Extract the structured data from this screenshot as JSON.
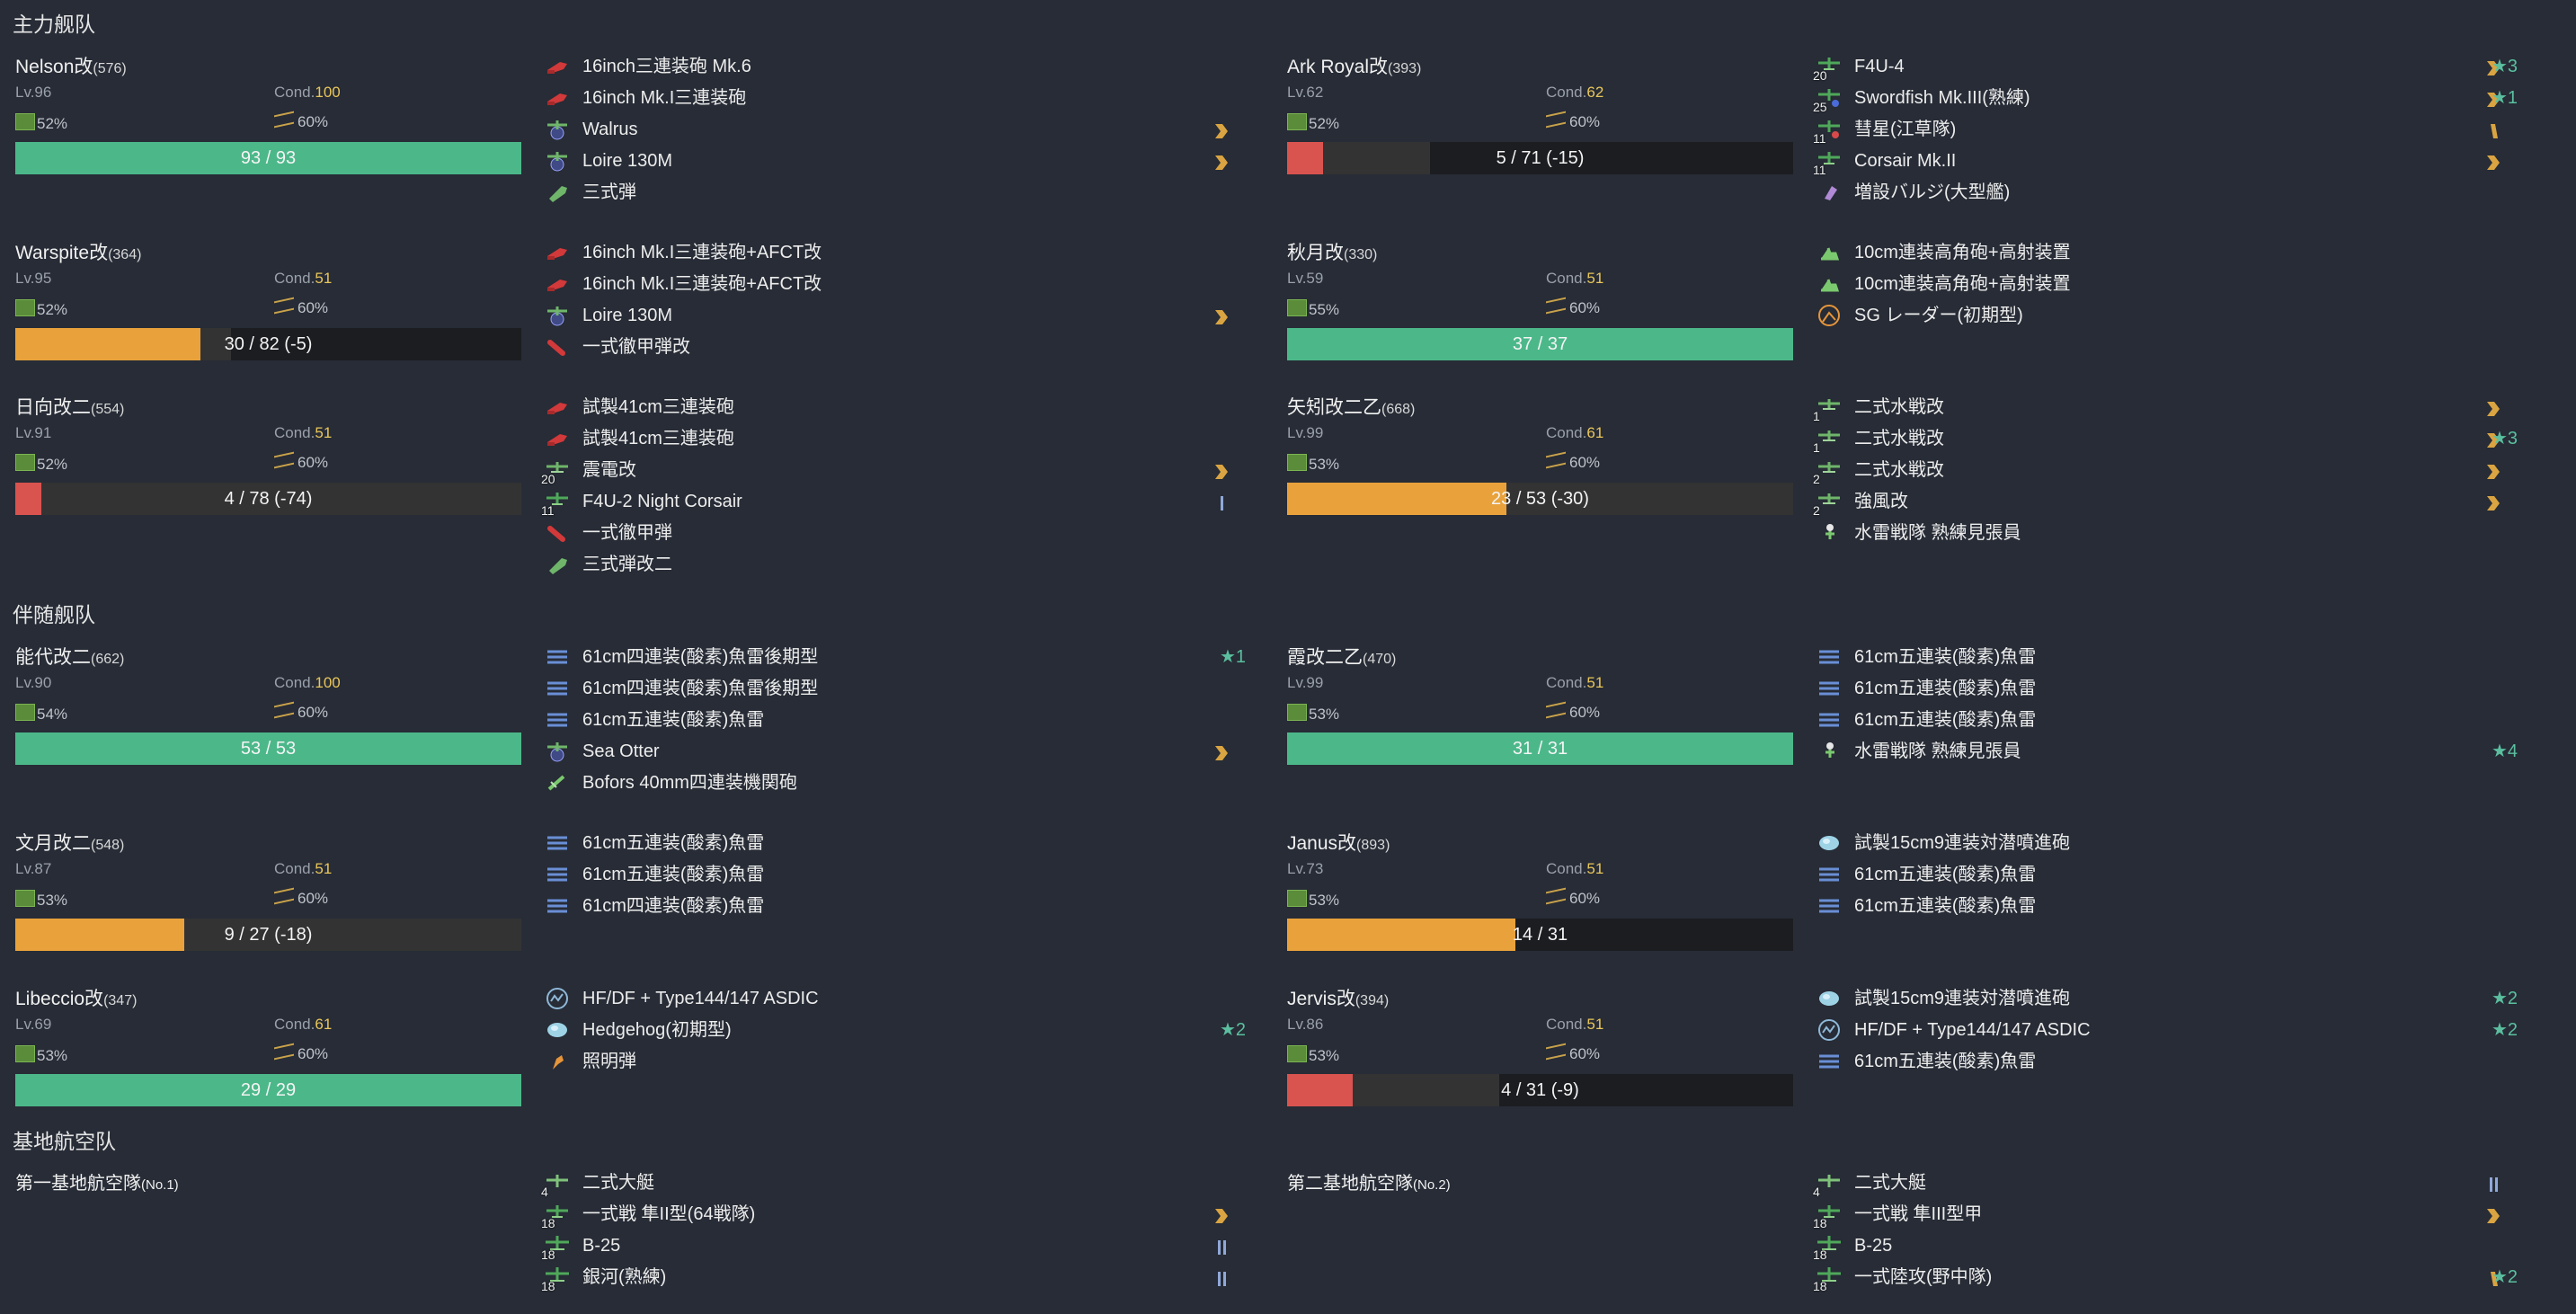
{
  "sections": {
    "main": "主力舰队",
    "escort": "伴随舰队",
    "base": "基地航空队"
  },
  "colors": {
    "green": "#4cb88a",
    "orange": "#e9a23b",
    "red": "#d9534f",
    "empty": "#333334",
    "dark": "#1c1d21"
  },
  "ships": [
    {
      "name": "Nelson改",
      "id": "(576)",
      "lv": "Lv.96",
      "cond_label": "Cond.",
      "cond": "100",
      "fuel": "52%",
      "ammo": "60%",
      "hp": "93 / 93",
      "hp_cur": 93,
      "hp_max": 93,
      "hp_after": 93,
      "hp_color": "green",
      "equips": [
        {
          "icon": "main-gun-red",
          "name": "16inch三連装砲 Mk.6"
        },
        {
          "icon": "main-gun-red",
          "name": "16inch Mk.I三連装砲"
        },
        {
          "icon": "seaplane",
          "name": "Walrus",
          "prof": "chevron"
        },
        {
          "icon": "seaplane",
          "name": "Loire 130M",
          "prof": "chevron"
        },
        {
          "icon": "ammo-green",
          "name": "三式弾"
        }
      ]
    },
    {
      "name": "Ark Royal改",
      "id": "(393)",
      "lv": "Lv.62",
      "cond_label": "Cond.",
      "cond": "62",
      "fuel": "52%",
      "ammo": "60%",
      "hp": "5 / 71 (-15)",
      "hp_cur": 5,
      "hp_max": 71,
      "hp_after": 20,
      "hp_color": "red",
      "equips": [
        {
          "icon": "fighter",
          "slot": "20",
          "name": "F4U-4",
          "prof": "chevron",
          "star": "★3"
        },
        {
          "icon": "torpedo-bomber",
          "slot": "25",
          "name": "Swordfish Mk.III(熟練)",
          "prof": "chevron",
          "star": "★1"
        },
        {
          "icon": "dive-bomber",
          "slot": "11",
          "name": "彗星(江草隊)",
          "prof": "bar"
        },
        {
          "icon": "fighter",
          "slot": "11",
          "name": "Corsair Mk.II",
          "prof": "chevron"
        },
        {
          "icon": "bulge",
          "name": "増設バルジ(大型艦)"
        }
      ]
    },
    {
      "name": "Warspite改",
      "id": "(364)",
      "lv": "Lv.95",
      "cond_label": "Cond.",
      "cond": "51",
      "fuel": "52%",
      "ammo": "60%",
      "hp": "30 / 82 (-5)",
      "hp_cur": 30,
      "hp_max": 82,
      "hp_after": 35,
      "hp_color": "orange",
      "equips": [
        {
          "icon": "main-gun-red",
          "name": "16inch Mk.I三連装砲+AFCT改"
        },
        {
          "icon": "main-gun-red",
          "name": "16inch Mk.I三連装砲+AFCT改"
        },
        {
          "icon": "seaplane",
          "name": "Loire 130M",
          "prof": "chevron"
        },
        {
          "icon": "ap-shell",
          "name": "一式徹甲弾改"
        }
      ]
    },
    {
      "name": "秋月改",
      "id": "(330)",
      "lv": "Lv.59",
      "cond_label": "Cond.",
      "cond": "51",
      "fuel": "55%",
      "ammo": "60%",
      "hp": "37 / 37",
      "hp_cur": 37,
      "hp_max": 37,
      "hp_after": 37,
      "hp_color": "green",
      "equips": [
        {
          "icon": "aa-gun",
          "name": "10cm連装高角砲+高射装置"
        },
        {
          "icon": "aa-gun",
          "name": "10cm連装高角砲+高射装置"
        },
        {
          "icon": "radar",
          "name": "SG レーダー(初期型)"
        }
      ]
    },
    {
      "name": "日向改二",
      "id": "(554)",
      "lv": "Lv.91",
      "cond_label": "Cond.",
      "cond": "51",
      "fuel": "52%",
      "ammo": "60%",
      "hp": "4 / 78 (-74)",
      "hp_cur": 4,
      "hp_max": 78,
      "hp_after": 78,
      "hp_color": "red",
      "equips": [
        {
          "icon": "main-gun-red",
          "name": "試製41cm三連装砲"
        },
        {
          "icon": "main-gun-red",
          "name": "試製41cm三連装砲"
        },
        {
          "icon": "seaplane-fighter",
          "slot": "20",
          "name": "震電改",
          "prof": "chevron"
        },
        {
          "icon": "fighter",
          "slot": "11",
          "name": "F4U-2 Night Corsair",
          "prof": "bar-blue"
        },
        {
          "icon": "ap-shell",
          "name": "一式徹甲弾"
        },
        {
          "icon": "ammo-green",
          "name": "三式弾改二"
        }
      ]
    },
    {
      "name": "矢矧改二乙",
      "id": "(668)",
      "lv": "Lv.99",
      "cond_label": "Cond.",
      "cond": "61",
      "fuel": "53%",
      "ammo": "60%",
      "hp": "23 / 53 (-30)",
      "hp_cur": 23,
      "hp_max": 53,
      "hp_after": 53,
      "hp_color": "orange",
      "equips": [
        {
          "icon": "seaplane-fighter",
          "slot": "1",
          "name": "二式水戦改",
          "prof": "chevron"
        },
        {
          "icon": "seaplane-fighter",
          "slot": "1",
          "name": "二式水戦改",
          "prof": "chevron",
          "star": "★3"
        },
        {
          "icon": "seaplane-fighter",
          "slot": "2",
          "name": "二式水戦改",
          "prof": "chevron"
        },
        {
          "icon": "seaplane-fighter",
          "slot": "2",
          "name": "強風改",
          "prof": "chevron"
        },
        {
          "icon": "lookout",
          "name": "水雷戦隊 熟練見張員"
        }
      ]
    },
    {
      "name": "能代改二",
      "id": "(662)",
      "lv": "Lv.90",
      "cond_label": "Cond.",
      "cond": "100",
      "fuel": "54%",
      "ammo": "60%",
      "hp": "53 / 53",
      "hp_cur": 53,
      "hp_max": 53,
      "hp_after": 53,
      "hp_color": "green",
      "equips": [
        {
          "icon": "torpedo",
          "name": "61cm四連装(酸素)魚雷後期型",
          "star": "★1"
        },
        {
          "icon": "torpedo",
          "name": "61cm四連装(酸素)魚雷後期型"
        },
        {
          "icon": "torpedo",
          "name": "61cm五連装(酸素)魚雷"
        },
        {
          "icon": "seaplane",
          "name": "Sea Otter",
          "prof": "chevron"
        },
        {
          "icon": "aa-machine",
          "name": "Bofors 40mm四連装機関砲"
        }
      ]
    },
    {
      "name": "霞改二乙",
      "id": "(470)",
      "lv": "Lv.99",
      "cond_label": "Cond.",
      "cond": "51",
      "fuel": "53%",
      "ammo": "60%",
      "hp": "31 / 31",
      "hp_cur": 31,
      "hp_max": 31,
      "hp_after": 31,
      "hp_color": "green",
      "equips": [
        {
          "icon": "torpedo",
          "name": "61cm五連装(酸素)魚雷"
        },
        {
          "icon": "torpedo",
          "name": "61cm五連装(酸素)魚雷"
        },
        {
          "icon": "torpedo",
          "name": "61cm五連装(酸素)魚雷"
        },
        {
          "icon": "lookout",
          "name": "水雷戦隊 熟練見張員",
          "star": "★4"
        }
      ]
    },
    {
      "name": "文月改二",
      "id": "(548)",
      "lv": "Lv.87",
      "cond_label": "Cond.",
      "cond": "51",
      "fuel": "53%",
      "ammo": "60%",
      "hp": "9 / 27 (-18)",
      "hp_cur": 9,
      "hp_max": 27,
      "hp_after": 27,
      "hp_color": "orange",
      "equips": [
        {
          "icon": "torpedo",
          "name": "61cm五連装(酸素)魚雷"
        },
        {
          "icon": "torpedo",
          "name": "61cm五連装(酸素)魚雷"
        },
        {
          "icon": "torpedo",
          "name": "61cm四連装(酸素)魚雷"
        }
      ]
    },
    {
      "name": "Janus改",
      "id": "(893)",
      "lv": "Lv.73",
      "cond_label": "Cond.",
      "cond": "51",
      "fuel": "53%",
      "ammo": "60%",
      "hp": "14 / 31",
      "hp_cur": 14,
      "hp_max": 31,
      "hp_after": 14,
      "hp_color": "orange",
      "equips": [
        {
          "icon": "asw",
          "name": "試製15cm9連装対潜噴進砲"
        },
        {
          "icon": "torpedo",
          "name": "61cm五連装(酸素)魚雷"
        },
        {
          "icon": "torpedo",
          "name": "61cm五連装(酸素)魚雷"
        }
      ]
    },
    {
      "name": "Libeccio改",
      "id": "(347)",
      "lv": "Lv.69",
      "cond_label": "Cond.",
      "cond": "61",
      "fuel": "53%",
      "ammo": "60%",
      "hp": "29 / 29",
      "hp_cur": 29,
      "hp_max": 29,
      "hp_after": 29,
      "hp_color": "green",
      "equips": [
        {
          "icon": "sonar",
          "name": "HF/DF + Type144/147 ASDIC"
        },
        {
          "icon": "asw",
          "name": "Hedgehog(初期型)",
          "star": "★2"
        },
        {
          "icon": "flare",
          "name": "照明弾"
        }
      ]
    },
    {
      "name": "Jervis改",
      "id": "(394)",
      "lv": "Lv.86",
      "cond_label": "Cond.",
      "cond": "51",
      "fuel": "53%",
      "ammo": "60%",
      "hp": "4 / 31 (-9)",
      "hp_cur": 4,
      "hp_max": 31,
      "hp_after": 13,
      "hp_color": "red",
      "equips": [
        {
          "icon": "asw",
          "name": "試製15cm9連装対潜噴進砲",
          "star": "★2"
        },
        {
          "icon": "sonar",
          "name": "HF/DF + Type144/147 ASDIC",
          "star": "★2"
        },
        {
          "icon": "torpedo",
          "name": "61cm五連装(酸素)魚雷"
        }
      ]
    }
  ],
  "bases": [
    {
      "name": "第一基地航空隊",
      "no": "(No.1)",
      "equips": [
        {
          "icon": "flying-boat",
          "slot": "4",
          "name": "二式大艇"
        },
        {
          "icon": "fighter",
          "slot": "18",
          "name": "一式戦 隼II型(64戦隊)",
          "prof": "chevron"
        },
        {
          "icon": "bomber",
          "slot": "18",
          "name": "B-25",
          "prof": "bar-blue2"
        },
        {
          "icon": "bomber",
          "slot": "18",
          "name": "銀河(熟練)",
          "prof": "bar-blue2"
        }
      ]
    },
    {
      "name": "第二基地航空隊",
      "no": "(No.2)",
      "equips": [
        {
          "icon": "flying-boat",
          "slot": "4",
          "name": "二式大艇",
          "prof": "bar-blue2"
        },
        {
          "icon": "fighter",
          "slot": "18",
          "name": "一式戦 隼III型甲",
          "prof": "chevron"
        },
        {
          "icon": "bomber",
          "slot": "18",
          "name": "B-25"
        },
        {
          "icon": "bomber",
          "slot": "18",
          "name": "一式陸攻(野中隊)",
          "prof": "bar",
          "star": "★2"
        }
      ]
    }
  ]
}
